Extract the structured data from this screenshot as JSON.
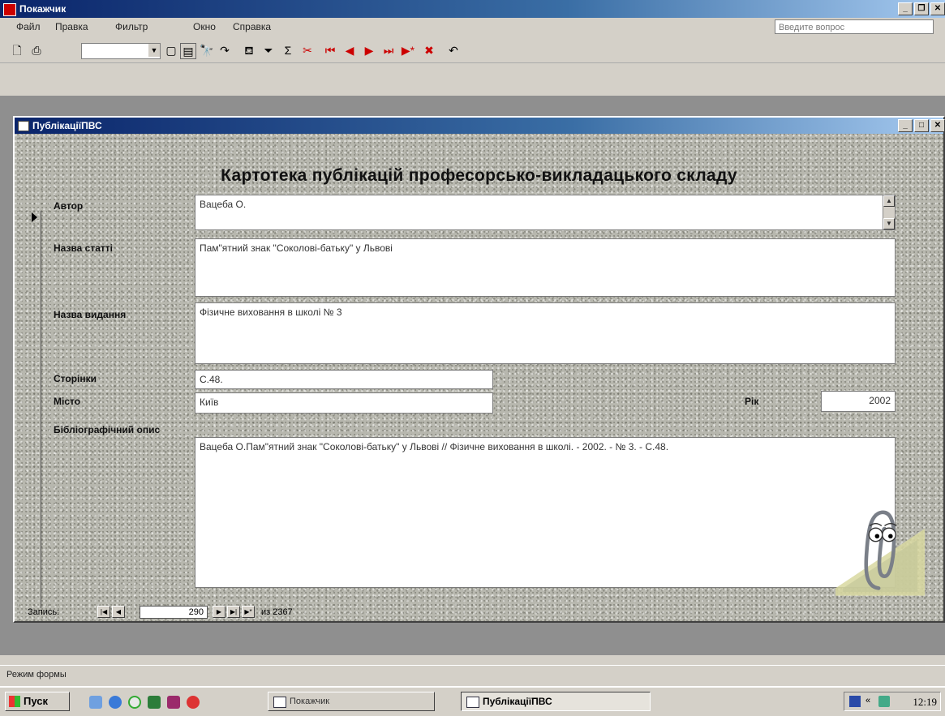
{
  "app": {
    "title": "Покажчик"
  },
  "menu": [
    {
      "label": "Файл"
    },
    {
      "label": "Правка"
    },
    {
      "label": "Фильтр"
    },
    {
      "label": "Окно"
    },
    {
      "label": "Справка"
    }
  ],
  "help_box": {
    "placeholder": "Введите вопрос"
  },
  "form": {
    "title": "ПублікаціїПВС",
    "heading": "Картотека публікацій  професорсько-викладацького складу",
    "fields": {
      "author": {
        "label": "Автор",
        "value": "Вацеба О."
      },
      "article_title": {
        "label": "Назва статті",
        "value": "Пам\"ятний знак \"Соколові-батьку\" у Львові"
      },
      "publication": {
        "label": "Назва видання",
        "value": "Фізичне виховання в школі № 3"
      },
      "pages": {
        "label": "Сторінки",
        "value": "С.48."
      },
      "city": {
        "label": "Місто",
        "value": "Київ"
      },
      "year": {
        "label": "Рік",
        "value": "2002"
      },
      "bibliographic": {
        "label": "Бібліографічний опис",
        "value": "Вацеба О.Пам\"ятний знак \"Соколові-батьку\" у Львові // Фізичне виховання в школі. - 2002. - № 3. - С.48."
      }
    },
    "nav": {
      "label": "Запись:",
      "current": "290",
      "of_text": "из 2367"
    }
  },
  "status_bar": {
    "text": "Режим формы"
  },
  "taskbar": {
    "start_label": "Пуск",
    "tasks": [
      {
        "label": "Покажчик"
      },
      {
        "label": "ПублікаціїПВС"
      }
    ],
    "clock": "12:19"
  },
  "colors": {
    "titlebar_start": "#0a246a",
    "titlebar_end": "#a6caf0",
    "window_bg": "#d4d0c8",
    "form_bg": "#b7b7ae"
  }
}
